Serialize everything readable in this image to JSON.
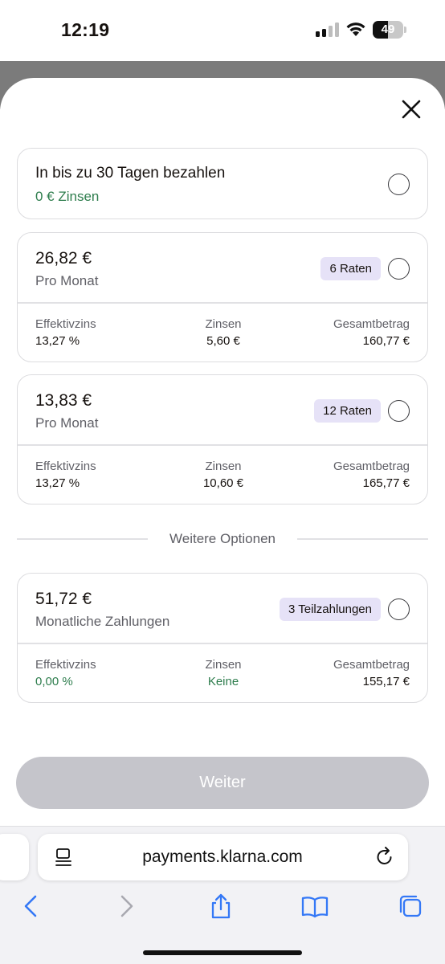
{
  "status_bar": {
    "time": "12:19",
    "battery": "49",
    "battery_level": 0.49
  },
  "sheet": {
    "options": [
      {
        "title": "In bis zu 30 Tagen bezahlen",
        "subtitle": "0 € Zinsen"
      }
    ],
    "plans": [
      {
        "amount": "26,82 €",
        "subtitle": "Pro Monat",
        "badge": "6 Raten",
        "stats": [
          {
            "label": "Effektivzins",
            "value": "13,27 %"
          },
          {
            "label": "Zinsen",
            "value": "5,60 €"
          },
          {
            "label": "Gesamtbetrag",
            "value": "160,77 €"
          }
        ]
      },
      {
        "amount": "13,83 €",
        "subtitle": "Pro Monat",
        "badge": "12 Raten",
        "stats": [
          {
            "label": "Effektivzins",
            "value": "13,27 %"
          },
          {
            "label": "Zinsen",
            "value": "10,60 €"
          },
          {
            "label": "Gesamtbetrag",
            "value": "165,77 €"
          }
        ]
      }
    ],
    "more_options_label": "Weitere Optionen",
    "more_plans": [
      {
        "amount": "51,72 €",
        "subtitle": "Monatliche Zahlungen",
        "badge": "3 Teilzahlungen",
        "stats": [
          {
            "label": "Effektivzins",
            "value": "0,00 %"
          },
          {
            "label": "Zinsen",
            "value": "Keine"
          },
          {
            "label": "Gesamtbetrag",
            "value": "155,17 €"
          }
        ]
      }
    ],
    "continue_label": "Weiter"
  },
  "browser": {
    "url": "payments.klarna.com",
    "toolbar_icons": [
      "back-icon",
      "forward-icon",
      "share-icon",
      "bookmarks-icon",
      "tabs-icon"
    ]
  },
  "colors": {
    "accent_green": "#2e7d4d",
    "badge_bg": "#e6e2f7",
    "button_disabled": "#c5c5cb",
    "safari_blue": "#3478f6"
  }
}
